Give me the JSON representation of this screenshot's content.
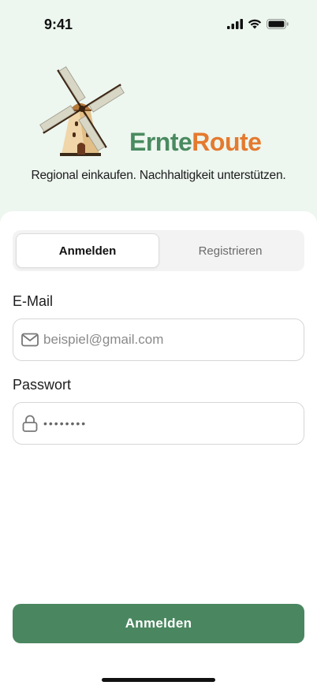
{
  "status_bar": {
    "time": "9:41"
  },
  "brand": {
    "part1": "Ernte",
    "part2": "Route",
    "tagline": "Regional einkaufen. Nachhaltigkeit unterstützen."
  },
  "tabs": [
    {
      "label": "Anmelden",
      "active": true
    },
    {
      "label": "Registrieren",
      "active": false
    }
  ],
  "form": {
    "email": {
      "label": "E-Mail",
      "placeholder": "beispiel@gmail.com",
      "icon": "envelope-icon"
    },
    "password": {
      "label": "Passwort",
      "value": "••••••••",
      "icon": "lock-icon"
    }
  },
  "submit_label": "Anmelden",
  "colors": {
    "accent": "#4a8760",
    "brand_green": "#4a8a60",
    "brand_orange": "#e47a2e",
    "hero_bg": "#edf6ef"
  }
}
